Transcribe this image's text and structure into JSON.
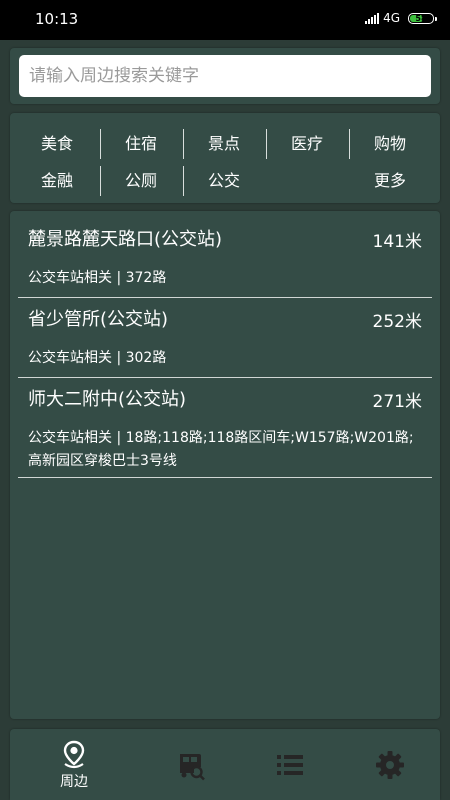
{
  "status_bar": {
    "time": "10:13",
    "network": "4G",
    "battery": {
      "level": 58,
      "label": "58"
    }
  },
  "search": {
    "placeholder": "请输入周边搜索关键字",
    "value": ""
  },
  "categories": [
    {
      "label": "美食"
    },
    {
      "label": "住宿"
    },
    {
      "label": "景点"
    },
    {
      "label": "医疗"
    },
    {
      "label": "购物"
    },
    {
      "label": "金融"
    },
    {
      "label": "公厕"
    },
    {
      "label": "公交"
    },
    {
      "label": "更多"
    }
  ],
  "results": [
    {
      "name": "麓景路麓天路口(公交站)",
      "distance": "141米",
      "detail": "公交车站相关 | 372路"
    },
    {
      "name": "省少管所(公交站)",
      "distance": "252米",
      "detail": "公交车站相关 | 302路"
    },
    {
      "name": "师大二附中(公交站)",
      "distance": "271米",
      "detail": "公交车站相关 | 18路;118路;118路区间车;W157路;W201路;高新园区穿梭巴士3号线"
    }
  ],
  "bottom_nav": [
    {
      "label": "周边",
      "icon": "location-pin-icon",
      "active": true
    },
    {
      "label": "",
      "icon": "bus-search-icon",
      "active": false
    },
    {
      "label": "",
      "icon": "list-icon",
      "active": false
    },
    {
      "label": "",
      "icon": "gear-icon",
      "active": false
    }
  ],
  "colors": {
    "background": "#2c3c37",
    "panel": "#344c46",
    "status_bar": "#000000",
    "battery_fill": "#3ec03e",
    "text": "#ffffff"
  }
}
